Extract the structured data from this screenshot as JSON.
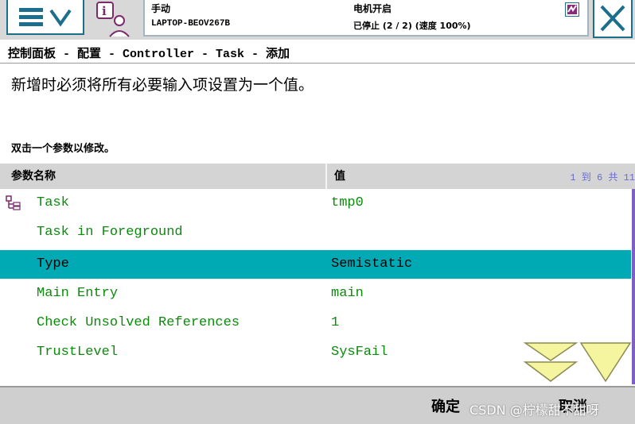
{
  "status": {
    "mode": "手动",
    "controller_name": "LAPTOP-BEOV267B",
    "motor_state": "电机开启",
    "run_state": "已停止 (2 / 2) (速度 100%)"
  },
  "icons": {
    "menu": "hamburger-menu-icon",
    "menu_expand": "chevron-down-icon",
    "status": "info-person-icon",
    "mini": "signal-icon",
    "close": "close-icon",
    "row": "task-structure-icon",
    "scroll_down": "double-chevron-down-icon",
    "scroll_bottom": "chevron-down-icon"
  },
  "breadcrumb": "控制面板 - 配置 - Controller - Task - 添加",
  "message": "新增时必须将所有必要输入项设置为一个值。",
  "hint": "双击一个参数以修改。",
  "table": {
    "header_name": "参数名称",
    "header_value": "值",
    "count": "1 到 6 共 11",
    "rows": [
      {
        "name": "Task",
        "value": "tmp0"
      },
      {
        "name": "Task in Foreground",
        "value": ""
      },
      {
        "name": "Type",
        "value": "Semistatic"
      },
      {
        "name": "Main Entry",
        "value": "main"
      },
      {
        "name": "Check Unsolved References",
        "value": "1"
      },
      {
        "name": "TrustLevel",
        "value": "SysFail"
      }
    ]
  },
  "buttons": {
    "ok": "确定",
    "cancel": "取消"
  },
  "watermark": "CSDN @柠檬甜不甜呀",
  "colors": {
    "selection": "#00aab5",
    "param_text": "#0c8a0c",
    "accent": "#1b6e8c"
  }
}
